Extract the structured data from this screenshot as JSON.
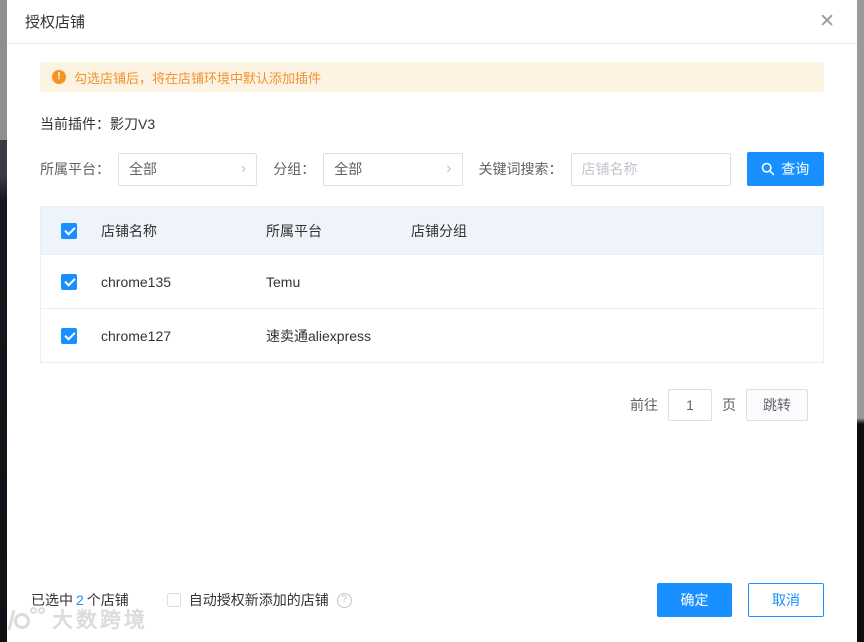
{
  "dialog": {
    "title": "授权店铺"
  },
  "icons": {
    "close": "✕",
    "chevron": "›",
    "warning": "!",
    "help": "?"
  },
  "banner": {
    "text": "勾选店铺后，将在店铺环境中默认添加插件"
  },
  "plugin": {
    "label": "当前插件：",
    "value": "影刀V3"
  },
  "filters": {
    "platform": {
      "label": "所属平台：",
      "value": "全部"
    },
    "group": {
      "label": "分组：",
      "value": "全部"
    },
    "keyword": {
      "label": "关键词搜索：",
      "placeholder": "店铺名称"
    },
    "search_button": "查询"
  },
  "table": {
    "header_checked": true,
    "columns": {
      "name": "店铺名称",
      "platform": "所属平台",
      "group": "店铺分组"
    },
    "rows": [
      {
        "checked": true,
        "name": "chrome135",
        "platform": "Temu",
        "group": ""
      },
      {
        "checked": true,
        "name": "chrome127",
        "platform": "速卖通aliexpress",
        "group": ""
      }
    ]
  },
  "pagination": {
    "prefix": "前往",
    "page_value": "1",
    "suffix": "页",
    "jump_button": "跳转"
  },
  "footer": {
    "selected_prefix": "已选中",
    "selected_count": "2",
    "selected_suffix": "个店铺",
    "auto_auth_checked": false,
    "auto_auth_label": "自动授权新添加的店铺",
    "confirm_button": "确定",
    "cancel_button": "取消"
  },
  "watermark": {
    "text": "大数跨境"
  },
  "colors": {
    "accent": "#1890ff",
    "warning_bg": "#fdf3e3",
    "warning_text": "#ef9430",
    "warning_icon": "#f59425",
    "table_header_bg": "#eff3fa",
    "border": "#dcdfe6"
  }
}
